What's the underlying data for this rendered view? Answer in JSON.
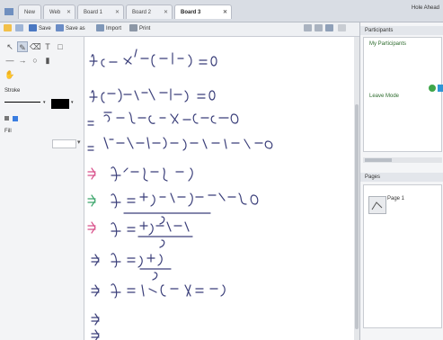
{
  "tabs": [
    {
      "label": "New"
    },
    {
      "label": "Web"
    },
    {
      "label": "Board 1"
    },
    {
      "label": "Board 2"
    },
    {
      "label": "Board 3",
      "active": true
    }
  ],
  "user_label": "Hole Ahead",
  "toolbar": {
    "save_label": "Save",
    "save_as_label": "Save as",
    "import_label": "Import",
    "print_label": "Print"
  },
  "sidebar": {
    "stroke_label": "Stroke",
    "fill_label": "Fill",
    "stroke_color": "#000000",
    "fill_color": "#3a7de0"
  },
  "right_panel": {
    "participants_title": "Participants",
    "group_label": "My Participants",
    "participant_label": "Leave Mode",
    "pages_title": "Pages",
    "page_label": "Page 1",
    "accent_color": "#3fa64a"
  }
}
